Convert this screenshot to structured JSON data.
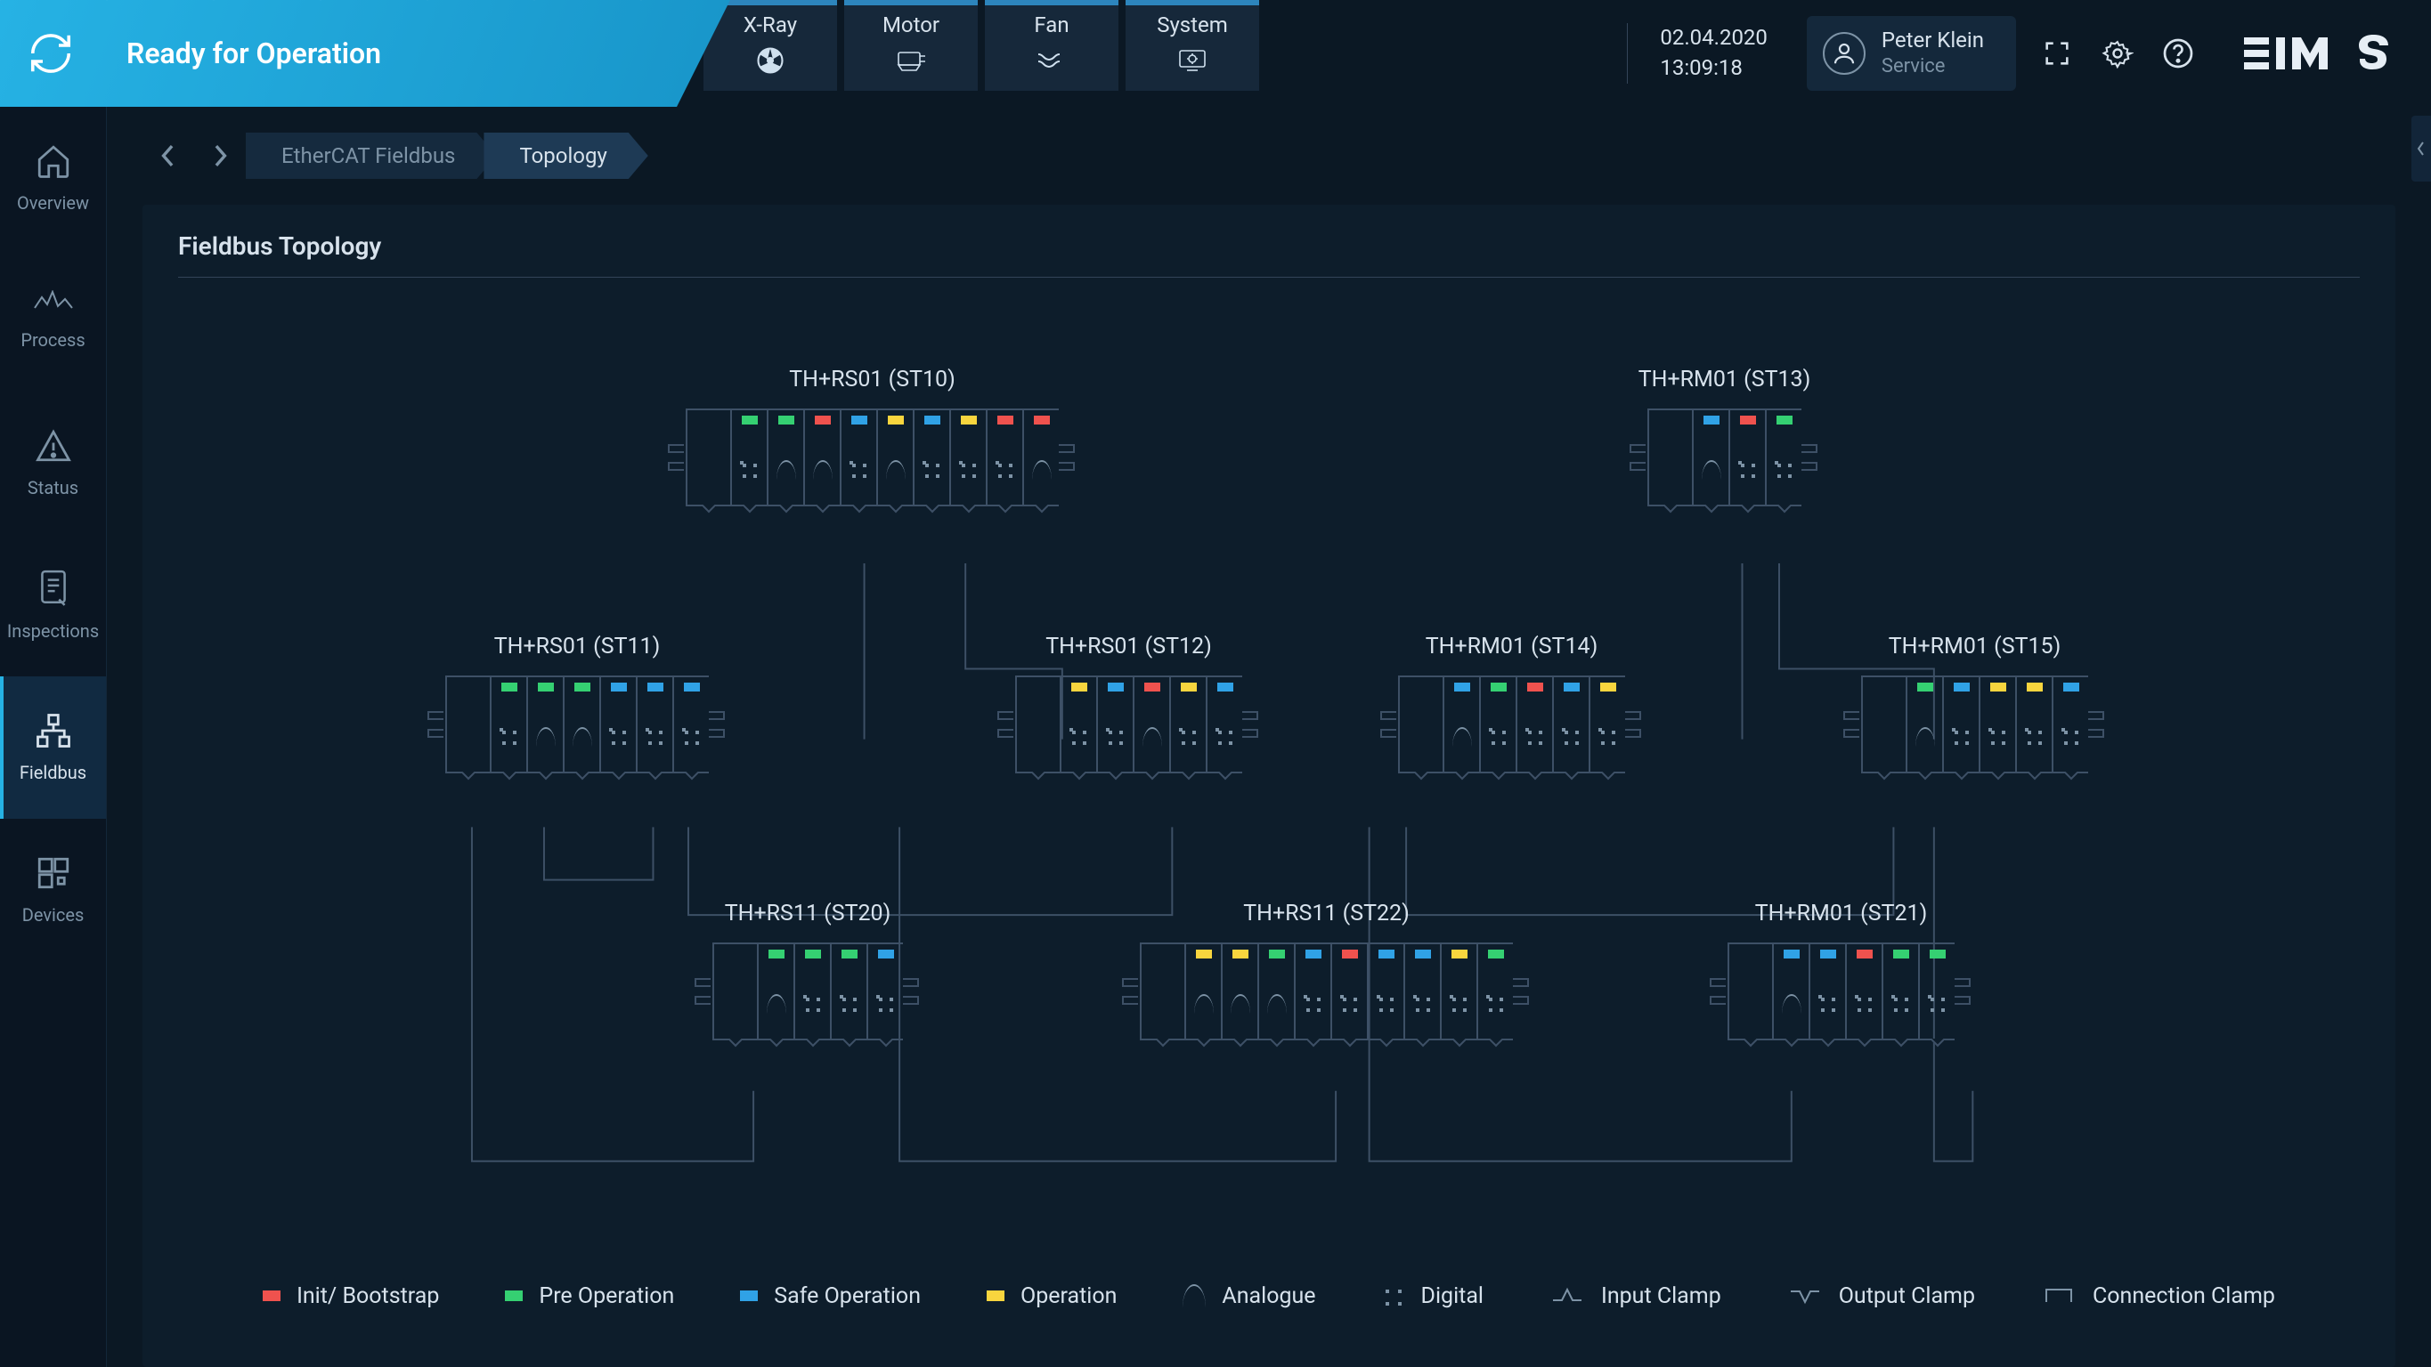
{
  "header": {
    "status_title": "Ready for Operation",
    "system_tabs": [
      {
        "id": "xray",
        "label": "X-Ray"
      },
      {
        "id": "motor",
        "label": "Motor"
      },
      {
        "id": "fan",
        "label": "Fan"
      },
      {
        "id": "system",
        "label": "System"
      }
    ],
    "date": "02.04.2020",
    "time": "13:09:18",
    "user": {
      "name": "Peter Klein",
      "role": "Service"
    },
    "logo_text": "IMS"
  },
  "sidebar": {
    "items": [
      {
        "id": "overview",
        "label": "Overview"
      },
      {
        "id": "process",
        "label": "Process"
      },
      {
        "id": "status",
        "label": "Status"
      },
      {
        "id": "inspections",
        "label": "Inspections"
      },
      {
        "id": "fieldbus",
        "label": "Fieldbus"
      },
      {
        "id": "devices",
        "label": "Devices"
      }
    ],
    "active": "fieldbus"
  },
  "breadcrumb": {
    "items": [
      {
        "label": "EtherCAT Fieldbus"
      },
      {
        "label": "Topology"
      }
    ],
    "active_index": 1
  },
  "panel": {
    "title": "Fieldbus Topology"
  },
  "legend": {
    "init": "Init/ Bootstrap",
    "preop": "Pre Operation",
    "safeop": "Safe Operation",
    "op": "Operation",
    "analogue": "Analogue",
    "digital": "Digital",
    "input_clamp": "Input Clamp",
    "output_clamp": "Output Clamp",
    "conn_clamp": "Connection Clamp"
  },
  "colors": {
    "init": "#ef524e",
    "preop": "#35d072",
    "safeop": "#30a2e6",
    "op": "#f8d53e"
  },
  "topology": {
    "nodes": [
      {
        "id": "st10",
        "title": "TH+RS01 (ST10)",
        "slots": [
          {
            "led": "green",
            "type": "digital"
          },
          {
            "led": "green",
            "type": "analogue"
          },
          {
            "led": "red",
            "type": "analogue"
          },
          {
            "led": "blue",
            "type": "digital"
          },
          {
            "led": "yellow",
            "type": "analogue"
          },
          {
            "led": "blue",
            "type": "digital"
          },
          {
            "led": "yellow",
            "type": "digital"
          },
          {
            "led": "red",
            "type": "digital"
          },
          {
            "led": "red",
            "type": "analogue"
          }
        ]
      },
      {
        "id": "st13",
        "title": "TH+RM01 (ST13)",
        "slots": [
          {
            "led": "blue",
            "type": "analogue"
          },
          {
            "led": "red",
            "type": "digital"
          },
          {
            "led": "green",
            "type": "digital"
          }
        ]
      },
      {
        "id": "st11",
        "title": "TH+RS01 (ST11)",
        "slots": [
          {
            "led": "green",
            "type": "digital"
          },
          {
            "led": "green",
            "type": "analogue"
          },
          {
            "led": "green",
            "type": "analogue"
          },
          {
            "led": "blue",
            "type": "digital"
          },
          {
            "led": "blue",
            "type": "digital"
          },
          {
            "led": "blue",
            "type": "digital"
          }
        ]
      },
      {
        "id": "st12",
        "title": "TH+RS01 (ST12)",
        "slots": [
          {
            "led": "yellow",
            "type": "digital"
          },
          {
            "led": "blue",
            "type": "digital"
          },
          {
            "led": "red",
            "type": "analogue"
          },
          {
            "led": "yellow",
            "type": "digital"
          },
          {
            "led": "blue",
            "type": "digital"
          }
        ]
      },
      {
        "id": "st14",
        "title": "TH+RM01 (ST14)",
        "slots": [
          {
            "led": "blue",
            "type": "analogue"
          },
          {
            "led": "green",
            "type": "digital"
          },
          {
            "led": "red",
            "type": "digital"
          },
          {
            "led": "blue",
            "type": "digital"
          },
          {
            "led": "yellow",
            "type": "digital"
          }
        ]
      },
      {
        "id": "st15",
        "title": "TH+RM01 (ST15)",
        "slots": [
          {
            "led": "green",
            "type": "analogue"
          },
          {
            "led": "blue",
            "type": "digital"
          },
          {
            "led": "yellow",
            "type": "digital"
          },
          {
            "led": "yellow",
            "type": "digital"
          },
          {
            "led": "blue",
            "type": "digital"
          }
        ]
      },
      {
        "id": "st20",
        "title": "TH+RS11 (ST20)",
        "slots": [
          {
            "led": "green",
            "type": "analogue"
          },
          {
            "led": "green",
            "type": "digital"
          },
          {
            "led": "green",
            "type": "digital"
          },
          {
            "led": "blue",
            "type": "digital"
          }
        ]
      },
      {
        "id": "st22",
        "title": "TH+RS11 (ST22)",
        "slots": [
          {
            "led": "yellow",
            "type": "analogue"
          },
          {
            "led": "yellow",
            "type": "analogue"
          },
          {
            "led": "green",
            "type": "analogue"
          },
          {
            "led": "blue",
            "type": "digital"
          },
          {
            "led": "red",
            "type": "digital"
          },
          {
            "led": "blue",
            "type": "digital"
          },
          {
            "led": "blue",
            "type": "digital"
          },
          {
            "led": "yellow",
            "type": "digital"
          },
          {
            "led": "green",
            "type": "digital"
          }
        ]
      },
      {
        "id": "st21",
        "title": "TH+RM01 (ST21)",
        "slots": [
          {
            "led": "blue",
            "type": "analogue"
          },
          {
            "led": "blue",
            "type": "digital"
          },
          {
            "led": "red",
            "type": "digital"
          },
          {
            "led": "green",
            "type": "digital"
          },
          {
            "led": "green",
            "type": "digital"
          }
        ]
      }
    ]
  }
}
